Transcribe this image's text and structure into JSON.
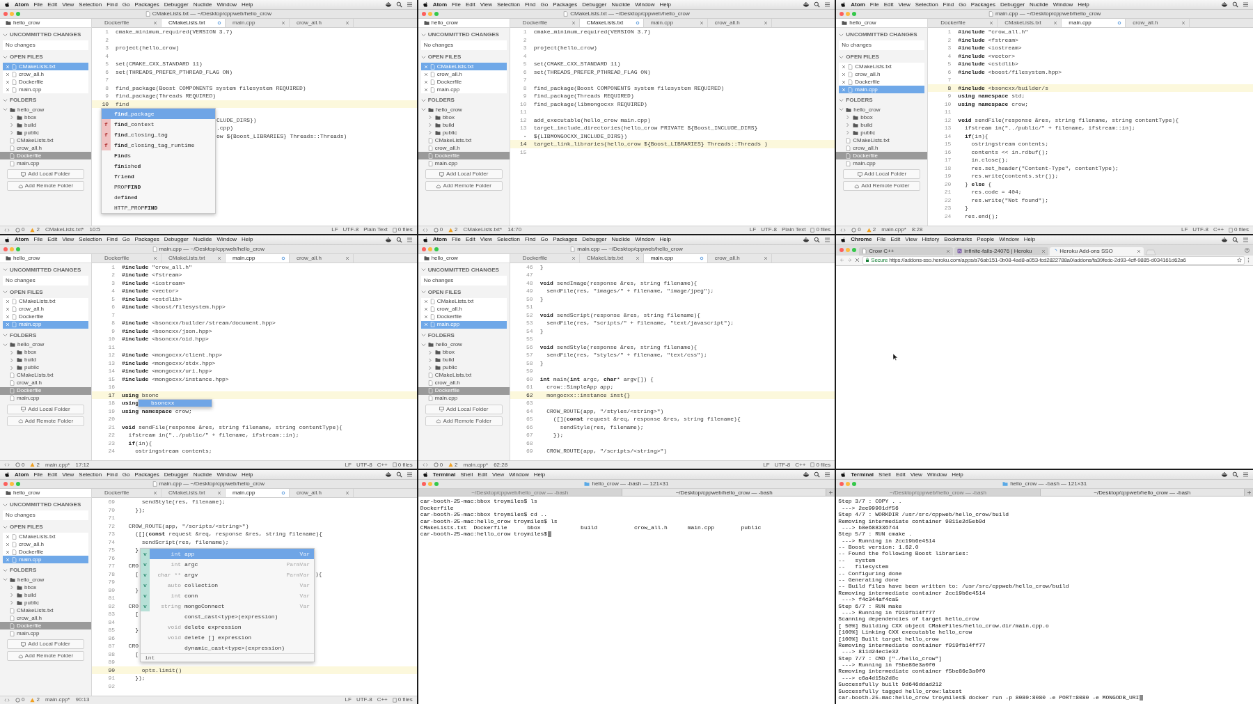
{
  "panels": [
    {
      "kind": "atom",
      "menubar": {
        "app": "Atom",
        "menus": [
          "File",
          "Edit",
          "View",
          "Selection",
          "Find",
          "Go",
          "Packages",
          "Debugger",
          "Nuclide",
          "Window",
          "Help"
        ]
      },
      "title": "CMakeLists.txt — ~/Desktop/cppweb/hello_crow",
      "project_tab": "hello_crow",
      "sidebar": {
        "uncommitted_heading": "UNCOMMITTED CHANGES",
        "uncommitted_text": "No changes",
        "open_files_heading": "OPEN FILES",
        "open_files": [
          {
            "name": "CMakeLists.txt",
            "selected": true
          },
          {
            "name": "crow_all.h",
            "selected": false
          },
          {
            "name": "Dockerfile",
            "selected": false
          },
          {
            "name": "main.cpp",
            "selected": false
          }
        ],
        "folders_heading": "FOLDERS",
        "tree": [
          {
            "name": "hello_crow",
            "kind": "folder",
            "expanded": true,
            "selected": false,
            "children": [
              {
                "name": "bbox",
                "kind": "folder",
                "expanded": false,
                "selected": false
              },
              {
                "name": "build",
                "kind": "folder",
                "expanded": false,
                "selected": false
              },
              {
                "name": "public",
                "kind": "folder",
                "expanded": false,
                "selected": false
              },
              {
                "name": "CMakeLists.txt",
                "kind": "file",
                "selected": false
              },
              {
                "name": "crow_all.h",
                "kind": "file",
                "selected": false
              },
              {
                "name": "Dockerfile",
                "kind": "file",
                "selected": true
              },
              {
                "name": "main.cpp",
                "kind": "file",
                "selected": false
              }
            ]
          }
        ],
        "buttons": [
          "Add Local Folder",
          "Add Remote Folder"
        ]
      },
      "tabs": [
        {
          "label": "Dockerfile",
          "selected": false,
          "modified": false
        },
        {
          "label": "CMakeLists.txt",
          "selected": true,
          "modified": true
        },
        {
          "label": "main.cpp",
          "selected": false,
          "modified": false
        },
        {
          "label": "crow_all.h",
          "selected": false,
          "modified": false
        }
      ],
      "lines": [
        {
          "number": "1",
          "text": "cmake_minimum_required(VERSION 3.7)",
          "current": false
        },
        {
          "number": "2",
          "current": false
        },
        {
          "number": "3",
          "text": "project(hello_crow)",
          "current": false
        },
        {
          "number": "4",
          "current": false
        },
        {
          "number": "5",
          "text": "set(CMAKE_CXX_STANDARD 11)",
          "current": false
        },
        {
          "number": "6",
          "text": "set(THREADS_PREFER_PTHREAD_FLAG ON)",
          "current": false
        },
        {
          "number": "7",
          "current": false
        },
        {
          "number": "8",
          "text": "find_package(Boost COMPONENTS system filesystem REQUIRED)",
          "current": false
        },
        {
          "number": "9",
          "text": "find_package(Threads REQUIRED)",
          "current": false
        },
        {
          "number": "10",
          "text": "find",
          "current": true
        },
        {
          "current": false
        },
        {
          "tail": "CLUDE_DIRS})",
          "current": false
        },
        {
          "tail": ".cpp)",
          "current": false
        },
        {
          "tail": "ow ${Boost_LIBRARIES} Threads::Threads)",
          "current": false
        }
      ],
      "autocomplete": {
        "items": [
          {
            "text": "**find**_package",
            "selected": true
          },
          {
            "badge": "f",
            "color": "#f0c2c2",
            "text": "**find**_context",
            "selected": false
          },
          {
            "badge": "f",
            "color": "#f0c2c2",
            "text": "**find**_closing_tag",
            "selected": false
          },
          {
            "badge": "f",
            "color": "#f0c2c2",
            "text": "**find**_closing_tag_runtime",
            "selected": false
          },
          {
            "text": "**Find**s",
            "selected": false
          },
          {
            "text": "**fin**ishe**d**",
            "selected": false
          },
          {
            "text": "**f**r**i**e**nd**",
            "selected": false
          },
          {
            "text": "PROP**FIND**",
            "selected": false
          },
          {
            "text": "de**fin**e**d**",
            "selected": false
          },
          {
            "text": "HTTP_PROP**FIND**",
            "selected": false
          }
        ]
      },
      "status": {
        "errors": "0",
        "warnings": "2",
        "file": "CMakeLists.txt*",
        "position": "10:5",
        "right": [
          "LF",
          "UTF-8",
          "Plain Text"
        ],
        "files": "0 files"
      }
    },
    {
      "kind": "atom",
      "menubar": {
        "app": "Atom",
        "menus": [
          "File",
          "Edit",
          "View",
          "Selection",
          "Find",
          "Go",
          "Packages",
          "Debugger",
          "Nuclide",
          "Window",
          "Help"
        ]
      },
      "title": "CMakeLists.txt — ~/Desktop/cppweb/hello_crow",
      "project_tab": "hello_crow",
      "sidebar": {
        "uncommitted_heading": "UNCOMMITTED CHANGES",
        "uncommitted_text": "No changes",
        "open_files_heading": "OPEN FILES",
        "open_files": [
          {
            "name": "CMakeLists.txt",
            "selected": true
          },
          {
            "name": "crow_all.h",
            "selected": false
          },
          {
            "name": "Dockerfile",
            "selected": false
          },
          {
            "name": "main.cpp",
            "selected": false
          }
        ],
        "folders_heading": "FOLDERS",
        "tree": [
          {
            "name": "hello_crow",
            "kind": "folder",
            "expanded": true,
            "selected": false,
            "children": [
              {
                "name": "bbox",
                "kind": "folder",
                "expanded": false,
                "selected": false
              },
              {
                "name": "build",
                "kind": "folder",
                "expanded": false,
                "selected": false
              },
              {
                "name": "public",
                "kind": "folder",
                "expanded": false,
                "selected": false
              },
              {
                "name": "CMakeLists.txt",
                "kind": "file",
                "selected": false
              },
              {
                "name": "crow_all.h",
                "kind": "file",
                "selected": false
              },
              {
                "name": "Dockerfile",
                "kind": "file",
                "selected": true
              },
              {
                "name": "main.cpp",
                "kind": "file",
                "selected": false
              }
            ]
          }
        ],
        "buttons": [
          "Add Local Folder",
          "Add Remote Folder"
        ]
      },
      "tabs": [
        {
          "label": "Dockerfile",
          "selected": false,
          "modified": false
        },
        {
          "label": "CMakeLists.txt",
          "selected": true,
          "modified": true
        },
        {
          "label": "main.cpp",
          "selected": false,
          "modified": false
        },
        {
          "label": "crow_all.h",
          "selected": false,
          "modified": false
        }
      ],
      "lines": [
        {
          "number": "1",
          "text": "cmake_minimum_required(VERSION 3.7)",
          "current": false
        },
        {
          "number": "2",
          "current": false
        },
        {
          "number": "3",
          "text": "project(hello_crow)",
          "current": false
        },
        {
          "number": "4",
          "current": false
        },
        {
          "number": "5",
          "text": "set(CMAKE_CXX_STANDARD 11)",
          "current": false
        },
        {
          "number": "6",
          "text": "set(THREADS_PREFER_PTHREAD_FLAG ON)",
          "current": false
        },
        {
          "number": "7",
          "current": false
        },
        {
          "number": "8",
          "text": "find_package(Boost COMPONENTS system filesystem REQUIRED)",
          "current": false
        },
        {
          "number": "9",
          "text": "find_package(Threads REQUIRED)",
          "current": false
        },
        {
          "number": "10",
          "text": "find_package(libmongocxx REQUIRED)",
          "current": false
        },
        {
          "number": "11",
          "current": false
        },
        {
          "number": "12",
          "text": "add_executable(hello_crow main.cpp)",
          "current": false
        },
        {
          "number": "13",
          "text": "target_include_directories(hello_crow PRIVATE ${Boost_INCLUDE_DIRS}",
          "current": false
        },
        {
          "number": "•",
          "text": "${LIBMONGOCXX_INCLUDE_DIRS})",
          "current": false
        },
        {
          "number": "14",
          "text": "target_link_libraries(hello_crow ${Boost_LIBRARIES} Threads::Threads )",
          "current": true
        },
        {
          "number": "15",
          "current": false
        }
      ],
      "status": {
        "errors": "0",
        "warnings": "2",
        "file": "CMakeLists.txt*",
        "position": "14:70",
        "right": [
          "LF",
          "UTF-8",
          "Plain Text"
        ],
        "files": "0 files"
      }
    },
    {
      "kind": "atom",
      "menubar": {
        "app": "Atom",
        "menus": [
          "File",
          "Edit",
          "View",
          "Selection",
          "Find",
          "Go",
          "Packages",
          "Debugger",
          "Nuclide",
          "Window",
          "Help"
        ]
      },
      "title": "main.cpp — ~/Desktop/cppweb/hello_crow",
      "project_tab": "hello_crow",
      "sidebar": {
        "uncommitted_heading": "UNCOMMITTED CHANGES",
        "uncommitted_text": "No changes",
        "open_files_heading": "OPEN FILES",
        "open_files": [
          {
            "name": "CMakeLists.txt",
            "selected": false
          },
          {
            "name": "crow_all.h",
            "selected": false
          },
          {
            "name": "Dockerfile",
            "selected": false
          },
          {
            "name": "main.cpp",
            "selected": true
          }
        ],
        "folders_heading": "FOLDERS",
        "tree": [
          {
            "name": "hello_crow",
            "kind": "folder",
            "expanded": true,
            "selected": false,
            "children": [
              {
                "name": "bbox",
                "kind": "folder",
                "expanded": false,
                "selected": false
              },
              {
                "name": "build",
                "kind": "folder",
                "expanded": false,
                "selected": false
              },
              {
                "name": "public",
                "kind": "folder",
                "expanded": false,
                "selected": false
              },
              {
                "name": "CMakeLists.txt",
                "kind": "file",
                "selected": false
              },
              {
                "name": "crow_all.h",
                "kind": "file",
                "selected": false
              },
              {
                "name": "Dockerfile",
                "kind": "file",
                "selected": true
              },
              {
                "name": "main.cpp",
                "kind": "file",
                "selected": false
              }
            ]
          }
        ],
        "buttons": [
          "Add Local Folder",
          "Add Remote Folder"
        ]
      },
      "tabs": [
        {
          "label": "Dockerfile",
          "selected": false,
          "modified": false
        },
        {
          "label": "CMakeLists.txt",
          "selected": false,
          "modified": false
        },
        {
          "label": "main.cpp",
          "selected": true,
          "modified": true
        },
        {
          "label": "crow_all.h",
          "selected": false,
          "modified": false
        }
      ],
      "lines": [
        {
          "number": "1",
          "text": "**#include** \"crow_all.h\"",
          "current": false
        },
        {
          "number": "2",
          "text": "**#include** <fstream>",
          "current": false
        },
        {
          "number": "3",
          "text": "**#include** <iostream>",
          "current": false
        },
        {
          "number": "4",
          "text": "**#include** <vector>",
          "current": false
        },
        {
          "number": "5",
          "text": "**#include** <cstdlib>",
          "current": false
        },
        {
          "number": "6",
          "text": "**#include** <boost/filesystem.hpp>",
          "current": false
        },
        {
          "number": "7",
          "current": false
        },
        {
          "number": "8",
          "text": "**#include** <bsoncxx/builder/s",
          "current": true
        },
        {
          "number": "9",
          "text": "**using namespace** std;",
          "current": false
        },
        {
          "number": "10",
          "text": "**using namespace** crow;",
          "current": false
        },
        {
          "number": "11",
          "current": false
        },
        {
          "number": "12",
          "text": "**void** sendFile(response &res, string filename, string contentType){",
          "current": false
        },
        {
          "number": "13",
          "text": "  ifstream in(\"../public/\" + filename, ifstream::in);",
          "current": false
        },
        {
          "number": "14",
          "text": "  **if**(in){",
          "current": false
        },
        {
          "number": "15",
          "text": "    ostringstream contents;",
          "current": false
        },
        {
          "number": "16",
          "text": "    contents << in.rdbuf();",
          "current": false
        },
        {
          "number": "17",
          "text": "    in.close();",
          "current": false
        },
        {
          "number": "18",
          "text": "    res.set_header(\"Content-Type\", contentType);",
          "current": false
        },
        {
          "number": "19",
          "text": "    res.write(contents.str());",
          "current": false
        },
        {
          "number": "20",
          "text": "  } **else** {",
          "current": false
        },
        {
          "number": "21",
          "text": "    res.code = 404;",
          "current": false
        },
        {
          "number": "22",
          "text": "    res.write(\"Not found\");",
          "current": false
        },
        {
          "number": "23",
          "text": "  }",
          "current": false
        },
        {
          "number": "24",
          "text": "  res.end();",
          "current": false
        }
      ],
      "status": {
        "errors": "0",
        "warnings": "2",
        "file": "main.cpp*",
        "position": "8:28",
        "right": [
          "LF",
          "UTF-8",
          "C++"
        ],
        "files": "0 files"
      }
    },
    {
      "kind": "atom",
      "menubar": {
        "app": "Atom",
        "menus": [
          "File",
          "Edit",
          "View",
          "Selection",
          "Find",
          "Go",
          "Packages",
          "Debugger",
          "Nuclide",
          "Window",
          "Help"
        ]
      },
      "title": "main.cpp — ~/Desktop/cppweb/hello_crow",
      "project_tab": "hello_crow",
      "sidebar": {
        "uncommitted_heading": "UNCOMMITTED CHANGES",
        "uncommitted_text": "No changes",
        "open_files_heading": "OPEN FILES",
        "open_files": [
          {
            "name": "CMakeLists.txt",
            "selected": false
          },
          {
            "name": "crow_all.h",
            "selected": false
          },
          {
            "name": "Dockerfile",
            "selected": false
          },
          {
            "name": "main.cpp",
            "selected": true
          }
        ],
        "folders_heading": "FOLDERS",
        "tree": [
          {
            "name": "hello_crow",
            "kind": "folder",
            "expanded": true,
            "selected": false,
            "children": [
              {
                "name": "bbox",
                "kind": "folder",
                "expanded": false,
                "selected": false
              },
              {
                "name": "build",
                "kind": "folder",
                "expanded": false,
                "selected": false
              },
              {
                "name": "public",
                "kind": "folder",
                "expanded": false,
                "selected": false
              },
              {
                "name": "CMakeLists.txt",
                "kind": "file",
                "selected": false
              },
              {
                "name": "crow_all.h",
                "kind": "file",
                "selected": false
              },
              {
                "name": "Dockerfile",
                "kind": "file",
                "selected": true
              },
              {
                "name": "main.cpp",
                "kind": "file",
                "selected": false
              }
            ]
          }
        ],
        "buttons": [
          "Add Local Folder",
          "Add Remote Folder"
        ]
      },
      "tabs": [
        {
          "label": "Dockerfile",
          "selected": false,
          "modified": false
        },
        {
          "label": "CMakeLists.txt",
          "selected": false,
          "modified": false
        },
        {
          "label": "main.cpp",
          "selected": true,
          "modified": true
        },
        {
          "label": "crow_all.h",
          "selected": false,
          "modified": false
        }
      ],
      "lines": [
        {
          "number": "1",
          "text": "**#include** \"crow_all.h\"",
          "current": false
        },
        {
          "number": "2",
          "text": "**#include** <fstream>",
          "current": false
        },
        {
          "number": "3",
          "text": "**#include** <iostream>",
          "current": false
        },
        {
          "number": "4",
          "text": "**#include** <vector>",
          "current": false
        },
        {
          "number": "5",
          "text": "**#include** <cstdlib>",
          "current": false
        },
        {
          "number": "6",
          "text": "**#include** <boost/filesystem.hpp>",
          "current": false
        },
        {
          "number": "7",
          "current": false
        },
        {
          "number": "8",
          "text": "**#include** <bsoncxx/builder/stream/document.hpp>",
          "current": false
        },
        {
          "number": "9",
          "text": "**#include** <bsoncxx/json.hpp>",
          "current": false
        },
        {
          "number": "10",
          "text": "**#include** <bsoncxx/oid.hpp>",
          "current": false
        },
        {
          "number": "11",
          "current": false
        },
        {
          "number": "12",
          "text": "**#include** <mongocxx/client.hpp>",
          "current": false
        },
        {
          "number": "13",
          "text": "**#include** <mongocxx/stdx.hpp>",
          "current": false
        },
        {
          "number": "14",
          "text": "**#include** <mongocxx/uri.hpp>",
          "current": false
        },
        {
          "number": "15",
          "text": "**#include** <mongocxx/instance.hpp>",
          "current": false
        },
        {
          "number": "16",
          "current": false
        },
        {
          "number": "17",
          "text": "**using** bsonc",
          "current": true
        },
        {
          "number": "18",
          "text": "**using**",
          "current": false
        },
        {
          "number": "19",
          "text": "**using namespace** crow;",
          "current": false
        },
        {
          "number": "20",
          "current": false
        },
        {
          "number": "21",
          "text": "**void** sendFile(response &res, string filename, string contentType){",
          "current": false
        },
        {
          "number": "22",
          "text": "  ifstream in(\"../public/\" + filename, ifstream::in);",
          "current": false
        },
        {
          "number": "23",
          "text": "  **if**(in){",
          "current": false
        },
        {
          "number": "24",
          "text": "    ostringstream contents;",
          "current": false
        }
      ],
      "autocomplete": {
        "items": [
          {
            "text": "bsoncxx",
            "selected": true
          }
        ]
      },
      "status": {
        "errors": "0",
        "warnings": "2",
        "file": "main.cpp*",
        "position": "17:12",
        "right": [
          "LF",
          "UTF-8",
          "C++"
        ],
        "files": "0 files"
      }
    },
    {
      "kind": "atom",
      "menubar": {
        "app": "Atom",
        "menus": [
          "File",
          "Edit",
          "View",
          "Selection",
          "Find",
          "Go",
          "Packages",
          "Debugger",
          "Nuclide",
          "Window",
          "Help"
        ]
      },
      "title": "main.cpp — ~/Desktop/cppweb/hello_crow",
      "project_tab": "hello_crow",
      "sidebar": {
        "uncommitted_heading": "UNCOMMITTED CHANGES",
        "uncommitted_text": "No changes",
        "open_files_heading": "OPEN FILES",
        "open_files": [
          {
            "name": "CMakeLists.txt",
            "selected": false
          },
          {
            "name": "crow_all.h",
            "selected": false
          },
          {
            "name": "Dockerfile",
            "selected": false
          },
          {
            "name": "main.cpp",
            "selected": true
          }
        ],
        "folders_heading": "FOLDERS",
        "tree": [
          {
            "name": "hello_crow",
            "kind": "folder",
            "expanded": true,
            "selected": false,
            "children": [
              {
                "name": "bbox",
                "kind": "folder",
                "expanded": false,
                "selected": false
              },
              {
                "name": "build",
                "kind": "folder",
                "expanded": false,
                "selected": false
              },
              {
                "name": "public",
                "kind": "folder",
                "expanded": false,
                "selected": false
              },
              {
                "name": "CMakeLists.txt",
                "kind": "file",
                "selected": false
              },
              {
                "name": "crow_all.h",
                "kind": "file",
                "selected": false
              },
              {
                "name": "Dockerfile",
                "kind": "file",
                "selected": true
              },
              {
                "name": "main.cpp",
                "kind": "file",
                "selected": false
              }
            ]
          }
        ],
        "buttons": [
          "Add Local Folder",
          "Add Remote Folder"
        ]
      },
      "tabs": [
        {
          "label": "Dockerfile",
          "selected": false,
          "modified": false
        },
        {
          "label": "CMakeLists.txt",
          "selected": false,
          "modified": false
        },
        {
          "label": "main.cpp",
          "selected": true,
          "modified": true
        },
        {
          "label": "crow_all.h",
          "selected": false,
          "modified": false
        }
      ],
      "lines": [
        {
          "number": "46",
          "text": "}",
          "current": false
        },
        {
          "number": "47",
          "current": false
        },
        {
          "number": "48",
          "text": "**void** sendImage(response &res, string filename){",
          "current": false
        },
        {
          "number": "49",
          "text": "  sendFile(res, \"images/\" + filename, \"image/jpeg\");",
          "current": false
        },
        {
          "number": "50",
          "text": "}",
          "current": false
        },
        {
          "number": "51",
          "current": false
        },
        {
          "number": "52",
          "text": "**void** sendScript(response &res, string filename){",
          "current": false
        },
        {
          "number": "53",
          "text": "  sendFile(res, \"scripts/\" + filename, \"text/javascript\");",
          "current": false
        },
        {
          "number": "54",
          "text": "}",
          "current": false
        },
        {
          "number": "55",
          "current": false
        },
        {
          "number": "56",
          "text": "**void** sendStyle(response &res, string filename){",
          "current": false
        },
        {
          "number": "57",
          "text": "  sendFile(res, \"styles/\" + filename, \"text/css\");",
          "current": false
        },
        {
          "number": "58",
          "text": "}",
          "current": false
        },
        {
          "number": "59",
          "current": false
        },
        {
          "number": "60",
          "text": "**int** main(**int** argc, **char*** argv[]) {",
          "current": false
        },
        {
          "number": "61",
          "text": "  crow::SimpleApp app;",
          "current": false
        },
        {
          "number": "62",
          "text": "  mongocxx::instance inst{}",
          "current": true
        },
        {
          "number": "63",
          "current": false
        },
        {
          "number": "64",
          "text": "  CROW_ROUTE(app, \"/styles/<string>\")",
          "current": false
        },
        {
          "number": "65",
          "text": "    ([](**const** request &req, response &res, string filename){",
          "current": false
        },
        {
          "number": "66",
          "text": "      sendStyle(res, filename);",
          "current": false
        },
        {
          "number": "67",
          "text": "    });",
          "current": false
        },
        {
          "number": "68",
          "current": false
        },
        {
          "number": "69",
          "text": "  CROW_ROUTE(app, \"/scripts/<string>\")",
          "current": false
        }
      ],
      "status": {
        "errors": "0",
        "warnings": "2",
        "file": "main.cpp*",
        "position": "62:28",
        "right": [
          "LF",
          "UTF-8",
          "C++"
        ],
        "files": "0 files"
      }
    },
    {
      "kind": "chrome",
      "menubar": {
        "app": "Chrome",
        "menus": [
          "File",
          "Edit",
          "View",
          "History",
          "Bookmarks",
          "People",
          "Window",
          "Help"
        ]
      },
      "tabs": [
        {
          "label": "Crow C++",
          "selected": false
        },
        {
          "label": "infinite-falls-24076 | Heroku",
          "selected": false
        },
        {
          "label": "Heroku Add-ons SSO",
          "selected": true
        }
      ],
      "secure_label": "Secure",
      "url": "https://addons-sso.heroku.com/apps/a76ab151-0b08-4ad8-a053-fcd2822788a0/addons/fa39fedc-2d93-4cff-9885-d034161d62a6"
    },
    {
      "kind": "atom",
      "menubar": {
        "app": "Atom",
        "menus": [
          "File",
          "Edit",
          "View",
          "Selection",
          "Find",
          "Go",
          "Packages",
          "Debugger",
          "Nuclide",
          "Window",
          "Help"
        ]
      },
      "title": "main.cpp — ~/Desktop/cppweb/hello_crow",
      "project_tab": "hello_crow",
      "sidebar": {
        "uncommitted_heading": "UNCOMMITTED CHANGES",
        "uncommitted_text": "No changes",
        "open_files_heading": "OPEN FILES",
        "open_files": [
          {
            "name": "CMakeLists.txt",
            "selected": false
          },
          {
            "name": "crow_all.h",
            "selected": false
          },
          {
            "name": "Dockerfile",
            "selected": false
          },
          {
            "name": "main.cpp",
            "selected": true
          }
        ],
        "folders_heading": "FOLDERS",
        "tree": [
          {
            "name": "hello_crow",
            "kind": "folder",
            "expanded": true,
            "selected": false,
            "children": [
              {
                "name": "bbox",
                "kind": "folder",
                "expanded": false,
                "selected": false
              },
              {
                "name": "build",
                "kind": "folder",
                "expanded": false,
                "selected": false
              },
              {
                "name": "public",
                "kind": "folder",
                "expanded": false,
                "selected": false
              },
              {
                "name": "CMakeLists.txt",
                "kind": "file",
                "selected": false
              },
              {
                "name": "crow_all.h",
                "kind": "file",
                "selected": false
              },
              {
                "name": "Dockerfile",
                "kind": "file",
                "selected": true
              },
              {
                "name": "main.cpp",
                "kind": "file",
                "selected": false
              }
            ]
          }
        ],
        "buttons": [
          "Add Local Folder",
          "Add Remote Folder"
        ]
      },
      "tabs": [
        {
          "label": "Dockerfile",
          "selected": false,
          "modified": false
        },
        {
          "label": "CMakeLists.txt",
          "selected": false,
          "modified": false
        },
        {
          "label": "main.cpp",
          "selected": true,
          "modified": true
        },
        {
          "label": "crow_all.h",
          "selected": false,
          "modified": false
        }
      ],
      "lines": [
        {
          "number": "69",
          "text": "      sendStyle(res, filename);",
          "current": false
        },
        {
          "number": "70",
          "text": "    });",
          "current": false
        },
        {
          "number": "71",
          "current": false
        },
        {
          "number": "72",
          "text": "  CROW_ROUTE(app, \"/scripts/<string>\")",
          "current": false
        },
        {
          "number": "73",
          "text": "    ([](**const** request &req, response &res, string filename){",
          "current": false
        },
        {
          "number": "74",
          "text": "      sendScript(res, filename);",
          "current": false
        },
        {
          "number": "75",
          "text": "    }",
          "current": false
        },
        {
          "number": "76",
          "current": false
        },
        {
          "number": "77",
          "text": "  CRO",
          "current": false
        },
        {
          "number": "78",
          "text": "    [",
          "tail": "){",
          "current": false
        },
        {
          "number": "79",
          "current": false
        },
        {
          "number": "80",
          "text": "    }",
          "current": false
        },
        {
          "number": "81",
          "current": false
        },
        {
          "number": "82",
          "text": "  CRO",
          "current": false
        },
        {
          "number": "83",
          "text": "    [",
          "current": false
        },
        {
          "number": "84",
          "current": false
        },
        {
          "number": "85",
          "text": "    }",
          "current": false
        },
        {
          "number": "86",
          "current": false
        },
        {
          "number": "87",
          "text": "  CRO",
          "current": false
        },
        {
          "number": "88",
          "text": "    [",
          "current": false
        },
        {
          "number": "89",
          "current": false
        },
        {
          "number": "90",
          "text": "      opts.limit()",
          "current": true
        },
        {
          "number": "91",
          "text": "    });",
          "current": false
        },
        {
          "number": "92",
          "current": false
        }
      ],
      "autocomplete": {
        "items": [
          {
            "badge": "v",
            "color": "#b7e0d7",
            "type": "int",
            "text": "app",
            "category": "Var",
            "selected": true
          },
          {
            "badge": "v",
            "color": "#b7e0d7",
            "type": "int",
            "text": "argc",
            "category": "ParmVar",
            "selected": false
          },
          {
            "badge": "v",
            "color": "#b7e0d7",
            "type": "char **",
            "text": "argv",
            "category": "ParmVar",
            "selected": false
          },
          {
            "badge": "v",
            "color": "#b7e0d7",
            "type": "auto",
            "text": "collection",
            "category": "Var",
            "selected": false
          },
          {
            "badge": "v",
            "color": "#b7e0d7",
            "type": "int",
            "text": "conn",
            "category": "Var",
            "selected": false
          },
          {
            "badge": "v",
            "color": "#b7e0d7",
            "type": "string",
            "text": "mongoConnect",
            "category": "Var",
            "selected": false
          },
          {
            "text": "const_cast<type>(expression)",
            "selected": false
          },
          {
            "type": "void",
            "text": "delete expression",
            "selected": false
          },
          {
            "type": "void",
            "text": "delete [] expression",
            "selected": false
          },
          {
            "text": "dynamic_cast<type>(expression)",
            "selected": false
          }
        ],
        "footer": "int"
      },
      "status": {
        "errors": "0",
        "warnings": "2",
        "file": "main.cpp*",
        "position": "90:13",
        "right": [
          "LF",
          "UTF-8",
          "C++"
        ],
        "files": "0 files"
      }
    },
    {
      "kind": "terminal",
      "menubar": {
        "app": "Terminal",
        "menus": [
          "Shell",
          "Edit",
          "View",
          "Window",
          "Help"
        ]
      },
      "title": "hello_crow — -bash — 121×31",
      "tabs": [
        {
          "label": "~/Desktop/cppweb/hello_crow — -bash",
          "selected": false
        },
        {
          "label": "~/Desktop/cppweb/hello_crow — -bash",
          "selected": true
        }
      ],
      "lines": [
        "car-booth-25-mac:bbox troymiles$ ls",
        "Dockerfile",
        "car-booth-25-mac:bbox troymiles$ cd ..",
        "car-booth-25-mac:hello_crow troymiles$ ls",
        "CMakeLists.txt  Dockerfile      bbox            build           crow_all.h      main.cpp        public",
        "car-booth-25-mac:hello_crow troymiles$"
      ]
    },
    {
      "kind": "terminal",
      "menubar": {
        "app": "Terminal",
        "menus": [
          "Shell",
          "Edit",
          "View",
          "Window",
          "Help"
        ]
      },
      "title": "hello_crow — -bash — 121×31",
      "tabs": [
        {
          "label": "~/Desktop/cppweb/hello_crow — -bash",
          "selected": false
        },
        {
          "label": "~/Desktop/cppweb/hello_crow — -bash",
          "selected": true
        }
      ],
      "lines": [
        "Step 3/7 : COPY . .",
        " ---> 2ee99901df56",
        "Step 4/7 : WORKDIR /usr/src/cppweb/hello_crow/build",
        "Removing intermediate container 9811e2d5eb9d",
        " ---> b8e688336744",
        "Step 5/7 : RUN cmake .",
        " ---> Running in 2cc19b6e4514",
        "-- Boost version: 1.62.0",
        "-- Found the following Boost libraries:",
        "--   system",
        "--   filesystem",
        "-- Configuring done",
        "-- Generating done",
        "-- Build files have been written to: /usr/src/cppweb/hello_crow/build",
        "Removing intermediate container 2cc19b6e4514",
        " ---> f4c344af4ca5",
        "Step 6/7 : RUN make",
        " ---> Running in f919fb14ff77",
        "Scanning dependencies of target hello_crow",
        "[ 50%] Building CXX object CMakeFiles/hello_crow.dir/main.cpp.o",
        "[100%] Linking CXX executable hello_crow",
        "[100%] Built target hello_crow",
        "Removing intermediate container f919fb14ff77",
        " ---> 811d24ec1e32",
        "Step 7/7 : CMD [\"./hello_crow\"]",
        " ---> Running in f5be86e3a0f0",
        "Removing intermediate container f5be86e3a0f0",
        " ---> c6a4d15b2d8c",
        "Successfully built 9d646ddad212",
        "Successfully tagged hello_crow:latest",
        "car-booth-25-mac:hello_crow troymiles$ docker run -p 8080:8080 -e PORT=8080 -e MONGODB_URI"
      ]
    }
  ]
}
